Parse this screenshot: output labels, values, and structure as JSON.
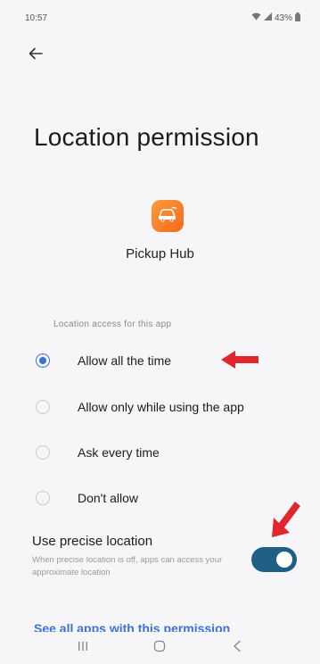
{
  "status_bar": {
    "time": "10:57",
    "battery": "43%"
  },
  "page": {
    "title": "Location permission"
  },
  "app": {
    "name": "Pickup Hub",
    "icon_color": "#f57c2a"
  },
  "access": {
    "section_label": "Location access for this app",
    "options": [
      {
        "label": "Allow all the time",
        "selected": true
      },
      {
        "label": "Allow only while using the app",
        "selected": false
      },
      {
        "label": "Ask every time",
        "selected": false
      },
      {
        "label": "Don't allow",
        "selected": false
      }
    ]
  },
  "precise_location": {
    "title": "Use precise location",
    "description": "When precise location is off, apps can access your approximate location",
    "enabled": true
  },
  "see_all_link": "See all apps with this permission",
  "colors": {
    "accent": "#3a72d8",
    "toggle_on": "#1f5f86",
    "annotation_arrow": "#e3262e"
  },
  "icons": {
    "back": "arrow-left-icon",
    "app": "car-icon",
    "annotation": "red-arrow-icon",
    "nav_recents": "recents-icon",
    "nav_home": "home-icon",
    "nav_back": "back-chevron-icon"
  }
}
